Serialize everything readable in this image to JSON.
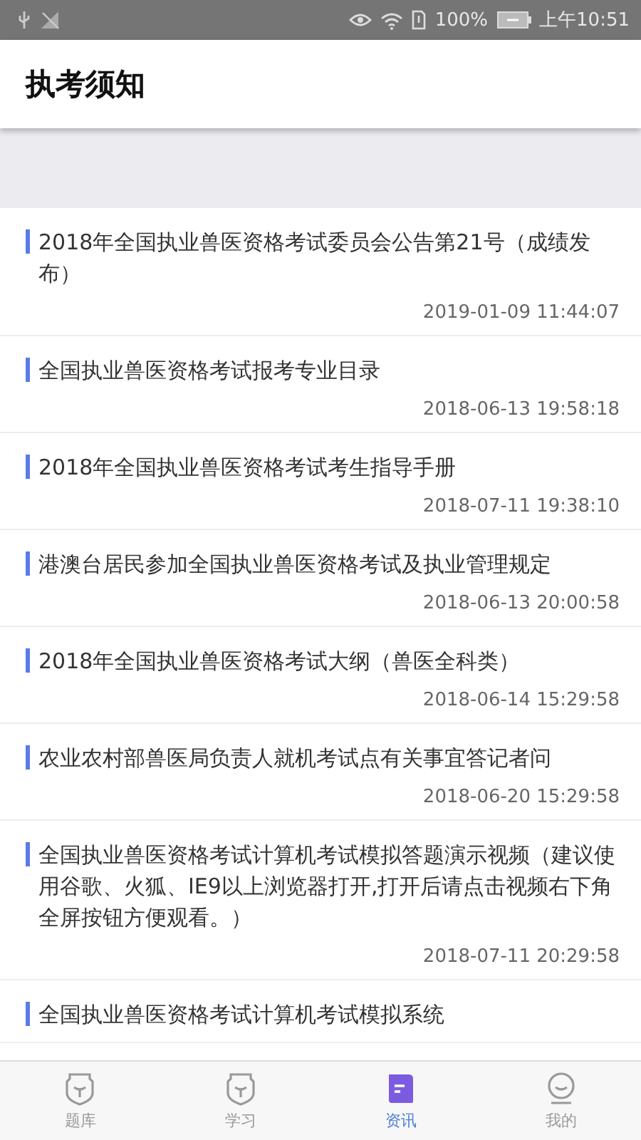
{
  "status_bar": {
    "battery_text": "100%",
    "time": "上午10:51"
  },
  "header": {
    "title": "执考须知"
  },
  "articles": [
    {
      "title": "2018年全国执业兽医资格考试委员会公告第21号（成绩发布）",
      "date": "2019-01-09 11:44:07"
    },
    {
      "title": "全国执业兽医资格考试报考专业目录",
      "date": "2018-06-13 19:58:18"
    },
    {
      "title": "2018年全国执业兽医资格考试考生指导手册",
      "date": "2018-07-11 19:38:10"
    },
    {
      "title": "港澳台居民参加全国执业兽医资格考试及执业管理规定",
      "date": "2018-06-13 20:00:58"
    },
    {
      "title": "2018年全国执业兽医资格考试大纲（兽医全科类）",
      "date": "2018-06-14 15:29:58"
    },
    {
      "title": "农业农村部兽医局负责人就机考试点有关事宜答记者问",
      "date": "2018-06-20 15:29:58"
    },
    {
      "title": "全国执业兽医资格考试计算机考试模拟答题演示视频（建议使用谷歌、火狐、IE9以上浏览器打开,打开后请点击视频右下角全屏按钮方便观看。）",
      "date": "2018-07-11 20:29:58"
    },
    {
      "title": "全国执业兽医资格考试计算机考试模拟系统"
    }
  ],
  "tabs": [
    {
      "label": "题库",
      "kind": "shield",
      "selected": false
    },
    {
      "label": "学习",
      "kind": "shield",
      "selected": false
    },
    {
      "label": "资讯",
      "kind": "news",
      "selected": true
    },
    {
      "label": "我的",
      "kind": "face",
      "selected": false
    }
  ]
}
